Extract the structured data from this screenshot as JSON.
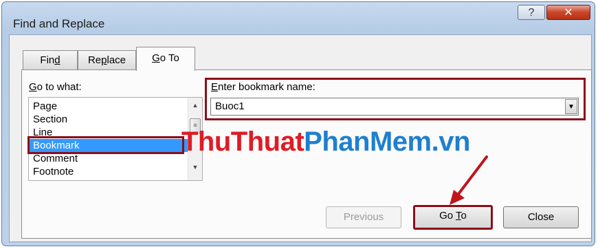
{
  "window": {
    "title": "Find and Replace",
    "help_label": "?",
    "close_label": "✕"
  },
  "tabs": [
    {
      "label": "Find",
      "underline": "d"
    },
    {
      "label": "Replace",
      "underline": "p"
    },
    {
      "label": "Go To",
      "underline": "G"
    }
  ],
  "goto": {
    "label": "Go to what:",
    "items": [
      "Page",
      "Section",
      "Line",
      "Bookmark",
      "Comment",
      "Footnote"
    ],
    "selected": "Bookmark"
  },
  "bookmark": {
    "label": "Enter bookmark name:",
    "value": "Buoc1"
  },
  "buttons": {
    "previous": "Previous",
    "goto": "Go To",
    "close": "Close"
  },
  "watermark": {
    "part1": "ThuThuat",
    "part2": "PhanMem.vn"
  },
  "colors": {
    "highlight": "#8b0e17",
    "selection": "#3399ff",
    "watermark_red": "#e01b24",
    "watermark_blue": "#1e7fcf"
  }
}
